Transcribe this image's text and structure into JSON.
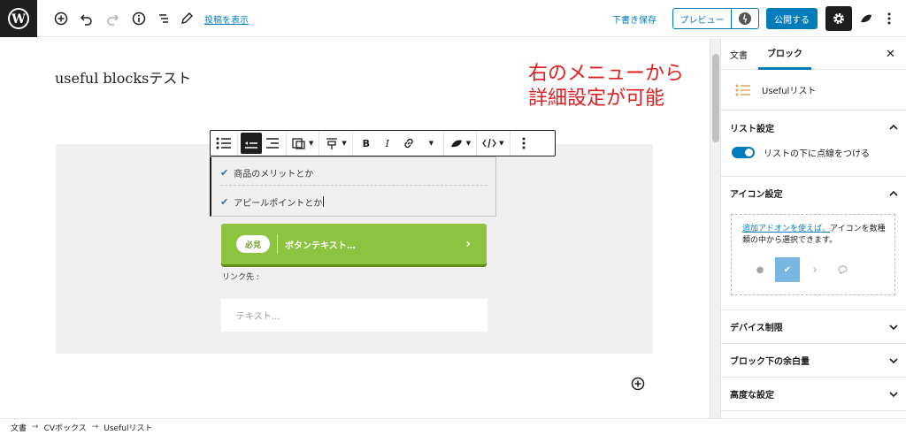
{
  "toolbar": {
    "show_post_link": "投稿を表示",
    "save_draft": "下書き保存",
    "preview": "プレビュー",
    "publish": "公開する"
  },
  "editor": {
    "post_title": "useful blocksテスト",
    "annotation": "右のメニューから\n詳細設定が可能",
    "list_items": [
      "商品のメリットとか",
      "アピールポイントとか"
    ],
    "cv_button": {
      "badge": "必見",
      "text": "ボタンテキスト…",
      "arrow": "›"
    },
    "link_label": "リンク先 :",
    "text_placeholder": "テキスト…"
  },
  "sidebar": {
    "tabs": [
      "文書",
      "ブロック"
    ],
    "active_tab": "ブロック",
    "block_card_title": "Usefulリスト",
    "panels": {
      "list_settings": "リスト設定",
      "toggle_label": "リストの下に点線をつける",
      "icon_settings": "アイコン設定",
      "addon_link": "追加アドオンを使えば、",
      "addon_text": "アイコンを数種類の中から選択できます。",
      "device_control": "デバイス制限",
      "block_margin": "ブロック下の余白量",
      "advanced": "高度な設定"
    }
  },
  "breadcrumb": [
    "文書",
    "CVボックス",
    "Usefulリスト"
  ],
  "breadcrumb_separator": "→",
  "colors": {
    "accent": "#007cba",
    "cv_button": "#8cc33f",
    "annotation": "#e02020",
    "dark": "#1e1e1e"
  }
}
